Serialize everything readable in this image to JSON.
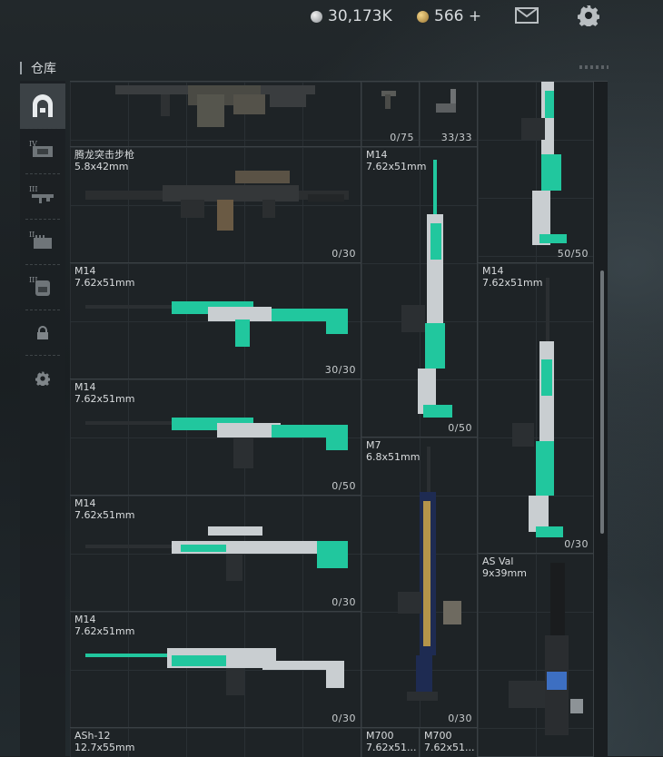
{
  "topbar": {
    "silver": "30,173K",
    "gold": "566 +"
  },
  "section": {
    "title": "仓库"
  },
  "sidebar": {
    "tabs": [
      {
        "id": "all",
        "tier": ""
      },
      {
        "id": "t4",
        "tier": "IV"
      },
      {
        "id": "t3a",
        "tier": "III"
      },
      {
        "id": "t2",
        "tier": "II"
      },
      {
        "id": "t3b",
        "tier": "III"
      },
      {
        "id": "lock",
        "tier": ""
      },
      {
        "id": "settings",
        "tier": ""
      }
    ]
  },
  "items": [
    {
      "name": "",
      "caliber": "",
      "ammo": ""
    },
    {
      "name": "",
      "caliber": "",
      "ammo": "0/75"
    },
    {
      "name": "",
      "caliber": "",
      "ammo": "33/33"
    },
    {
      "name": "",
      "caliber": "",
      "ammo": "50/50"
    },
    {
      "name": "腾龙突击步枪",
      "caliber": "5.8x42mm",
      "ammo": "0/30"
    },
    {
      "name": "M14",
      "caliber": "7.62x51mm",
      "ammo": "0/50"
    },
    {
      "name": "M14",
      "caliber": "7.62x51mm",
      "ammo": "30/30"
    },
    {
      "name": "M14",
      "caliber": "7.62x51mm",
      "ammo": "0/30"
    },
    {
      "name": "M14",
      "caliber": "7.62x51mm",
      "ammo": "0/50"
    },
    {
      "name": "M7",
      "caliber": "6.8x51mm",
      "ammo": "0/30"
    },
    {
      "name": "M14",
      "caliber": "7.62x51mm",
      "ammo": "0/30"
    },
    {
      "name": "AS Val",
      "caliber": "9x39mm",
      "ammo": ""
    },
    {
      "name": "M14",
      "caliber": "7.62x51mm",
      "ammo": "0/30"
    },
    {
      "name": "ASh-12",
      "caliber": "12.7x55mm",
      "ammo": ""
    },
    {
      "name": "M700",
      "caliber": "7.62x51...",
      "ammo": ""
    },
    {
      "name": "M700",
      "caliber": "7.62x51...",
      "ammo": ""
    }
  ],
  "colors": {
    "accent": "#21c79e",
    "steel": "#c9ced1",
    "gunmetal": "#2b2f32"
  }
}
